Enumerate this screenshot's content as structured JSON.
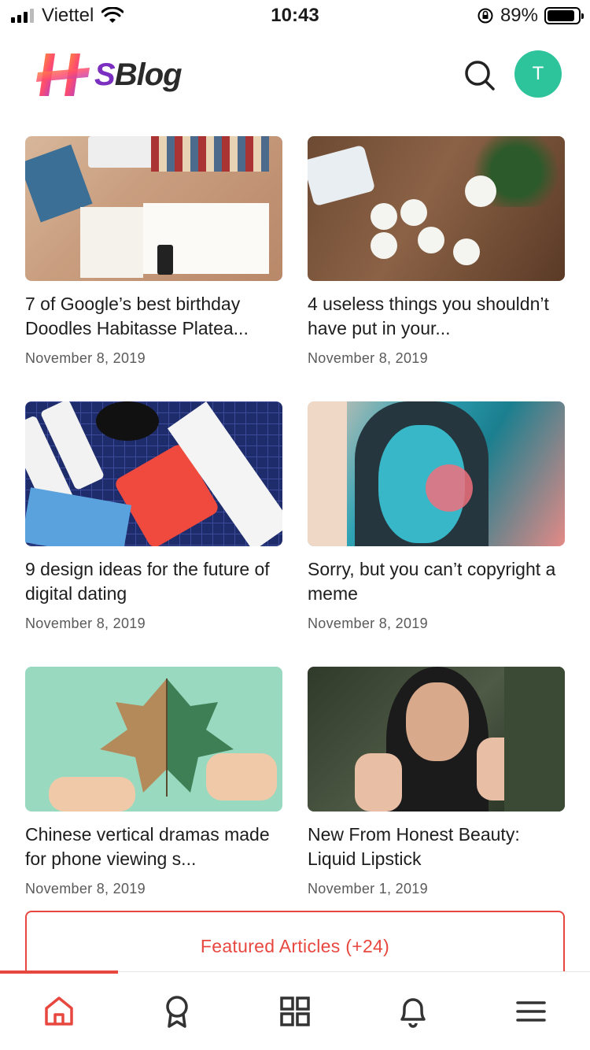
{
  "status_bar": {
    "carrier": "Viettel",
    "time": "10:43",
    "battery": "89%"
  },
  "header": {
    "logo_letter": "S",
    "logo_text": "Blog",
    "avatar_initial": "T"
  },
  "articles": [
    {
      "title": "7 of Google’s best birthday Doodles Habitasse Platea...",
      "date": "November 8, 2019"
    },
    {
      "title": "4 useless things you shouldn’t have put in your...",
      "date": "November 8, 2019"
    },
    {
      "title": "9 design ideas for the future of digital dating",
      "date": "November 8, 2019"
    },
    {
      "title": "Sorry, but you can’t copyright a meme",
      "date": "November 8, 2019"
    },
    {
      "title": "Chinese vertical dramas made for phone viewing s...",
      "date": "November 8, 2019"
    },
    {
      "title": "New From Honest Beauty: Liquid Lipstick",
      "date": "November 1, 2019"
    }
  ],
  "featured_button": {
    "label": "Featured Articles (+24)"
  },
  "bottom_nav": {
    "items": [
      {
        "icon": "home-icon",
        "active": true
      },
      {
        "icon": "award-icon",
        "active": false
      },
      {
        "icon": "grid-icon",
        "active": false
      },
      {
        "icon": "bell-icon",
        "active": false
      },
      {
        "icon": "menu-icon",
        "active": false
      }
    ]
  },
  "colors": {
    "accent": "#e8473f",
    "avatar": "#2ec49b",
    "text": "#1d1d1d",
    "muted": "#5a5a5a"
  }
}
